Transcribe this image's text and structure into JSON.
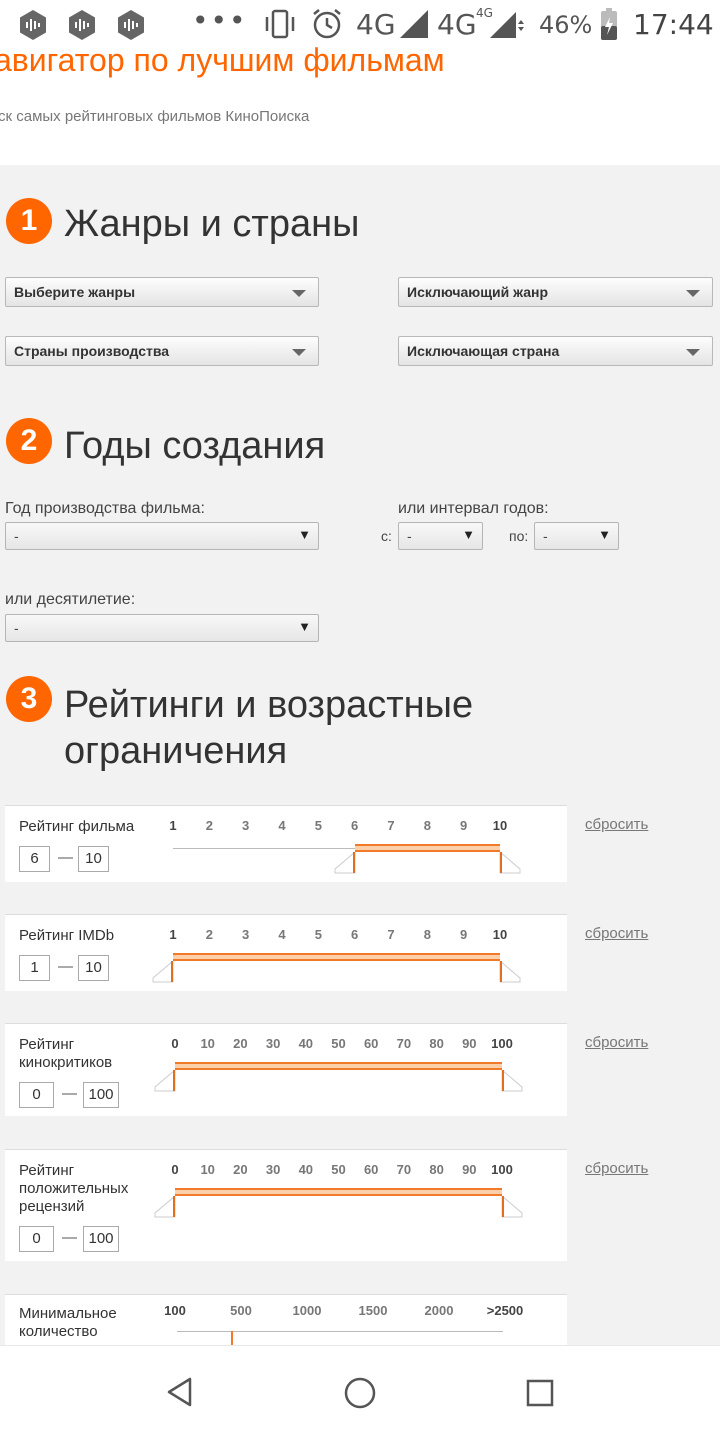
{
  "status_bar": {
    "dots": "•••",
    "network1": "4G",
    "network2": "4G",
    "network2_sup": "4G",
    "battery": "46%",
    "time": "17:44"
  },
  "header": {
    "title": "авигатор по лучшим фильмам",
    "subtitle": "ск самых рейтинговых фильмов КиноПоиска"
  },
  "sections": [
    {
      "number": "1",
      "title": "Жанры и страны"
    },
    {
      "number": "2",
      "title": "Годы создания"
    },
    {
      "number": "3",
      "title_line1": "Рейтинги и возрастные",
      "title_line2": "ограничения"
    }
  ],
  "genres": {
    "genres_select": "Выберите жанры",
    "exclude_genre_select": "Исключающий жанр",
    "countries_select": "Страны производства",
    "exclude_country_select": "Исключающая страна"
  },
  "years": {
    "year_label": "Год производства фильма:",
    "year_value": "-",
    "interval_label": "или интервал годов:",
    "from_label": "с:",
    "from_value": "-",
    "to_label": "по:",
    "to_value": "-",
    "decade_label": "или десятилетие:",
    "decade_value": "-"
  },
  "ratings": [
    {
      "label_lines": [
        "Рейтинг фильма"
      ],
      "ticks": [
        "1",
        "2",
        "3",
        "4",
        "5",
        "6",
        "7",
        "8",
        "9",
        "10"
      ],
      "min": "6",
      "max": "10",
      "selected_from": 6,
      "selected_to": 10,
      "reset": "сбросить"
    },
    {
      "label_lines": [
        "Рейтинг IMDb"
      ],
      "ticks": [
        "1",
        "2",
        "3",
        "4",
        "5",
        "6",
        "7",
        "8",
        "9",
        "10"
      ],
      "min": "1",
      "max": "10",
      "selected_from": 1,
      "selected_to": 10,
      "reset": "сбросить"
    },
    {
      "label_lines": [
        "Рейтинг",
        "кинокритиков"
      ],
      "ticks": [
        "0",
        "10",
        "20",
        "30",
        "40",
        "50",
        "60",
        "70",
        "80",
        "90",
        "100"
      ],
      "min": "0",
      "max": "100",
      "selected_from": 0,
      "selected_to": 100,
      "reset": "сбросить"
    },
    {
      "label_lines": [
        "Рейтинг",
        "положительных",
        "рецензий"
      ],
      "ticks": [
        "0",
        "10",
        "20",
        "30",
        "40",
        "50",
        "60",
        "70",
        "80",
        "90",
        "100"
      ],
      "min": "0",
      "max": "100",
      "selected_from": 0,
      "selected_to": 100,
      "reset": "сбросить"
    },
    {
      "label_lines": [
        "Минимальное",
        "количество"
      ],
      "ticks": [
        "100",
        "500",
        "1000",
        "1500",
        "2000",
        ">2500"
      ],
      "selected_from": "500"
    }
  ],
  "nav": {
    "back": "back-icon",
    "home": "home-icon",
    "recents": "recents-icon"
  }
}
